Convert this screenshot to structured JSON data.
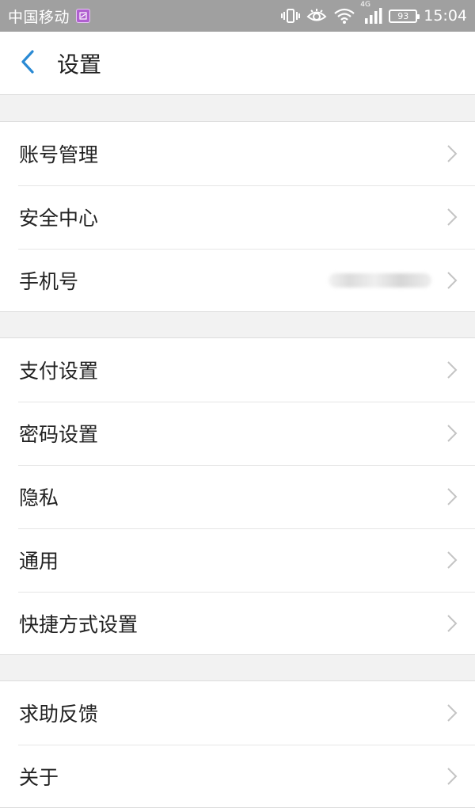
{
  "status_bar": {
    "carrier": "中国移动",
    "network": "4G",
    "battery": "93",
    "time": "15:04",
    "icons": [
      "message-icon",
      "vibrate-icon",
      "eye-icon",
      "wifi-icon",
      "signal-icon",
      "battery-icon"
    ]
  },
  "header": {
    "title": "设置",
    "back_icon": "chevron-left-icon",
    "accent_color": "#2a8ad4"
  },
  "groups": [
    {
      "items": [
        {
          "label": "账号管理"
        },
        {
          "label": "安全中心"
        },
        {
          "label": "手机号",
          "value": "•••••••••••"
        }
      ]
    },
    {
      "items": [
        {
          "label": "支付设置"
        },
        {
          "label": "密码设置"
        },
        {
          "label": "隐私"
        },
        {
          "label": "通用"
        },
        {
          "label": "快捷方式设置"
        }
      ]
    },
    {
      "items": [
        {
          "label": "求助反馈"
        },
        {
          "label": "关于"
        }
      ]
    }
  ],
  "colors": {
    "status_bar_bg": "#a0a0a0",
    "page_bg": "#f2f2f2",
    "chevron": "#c4c4c4"
  }
}
